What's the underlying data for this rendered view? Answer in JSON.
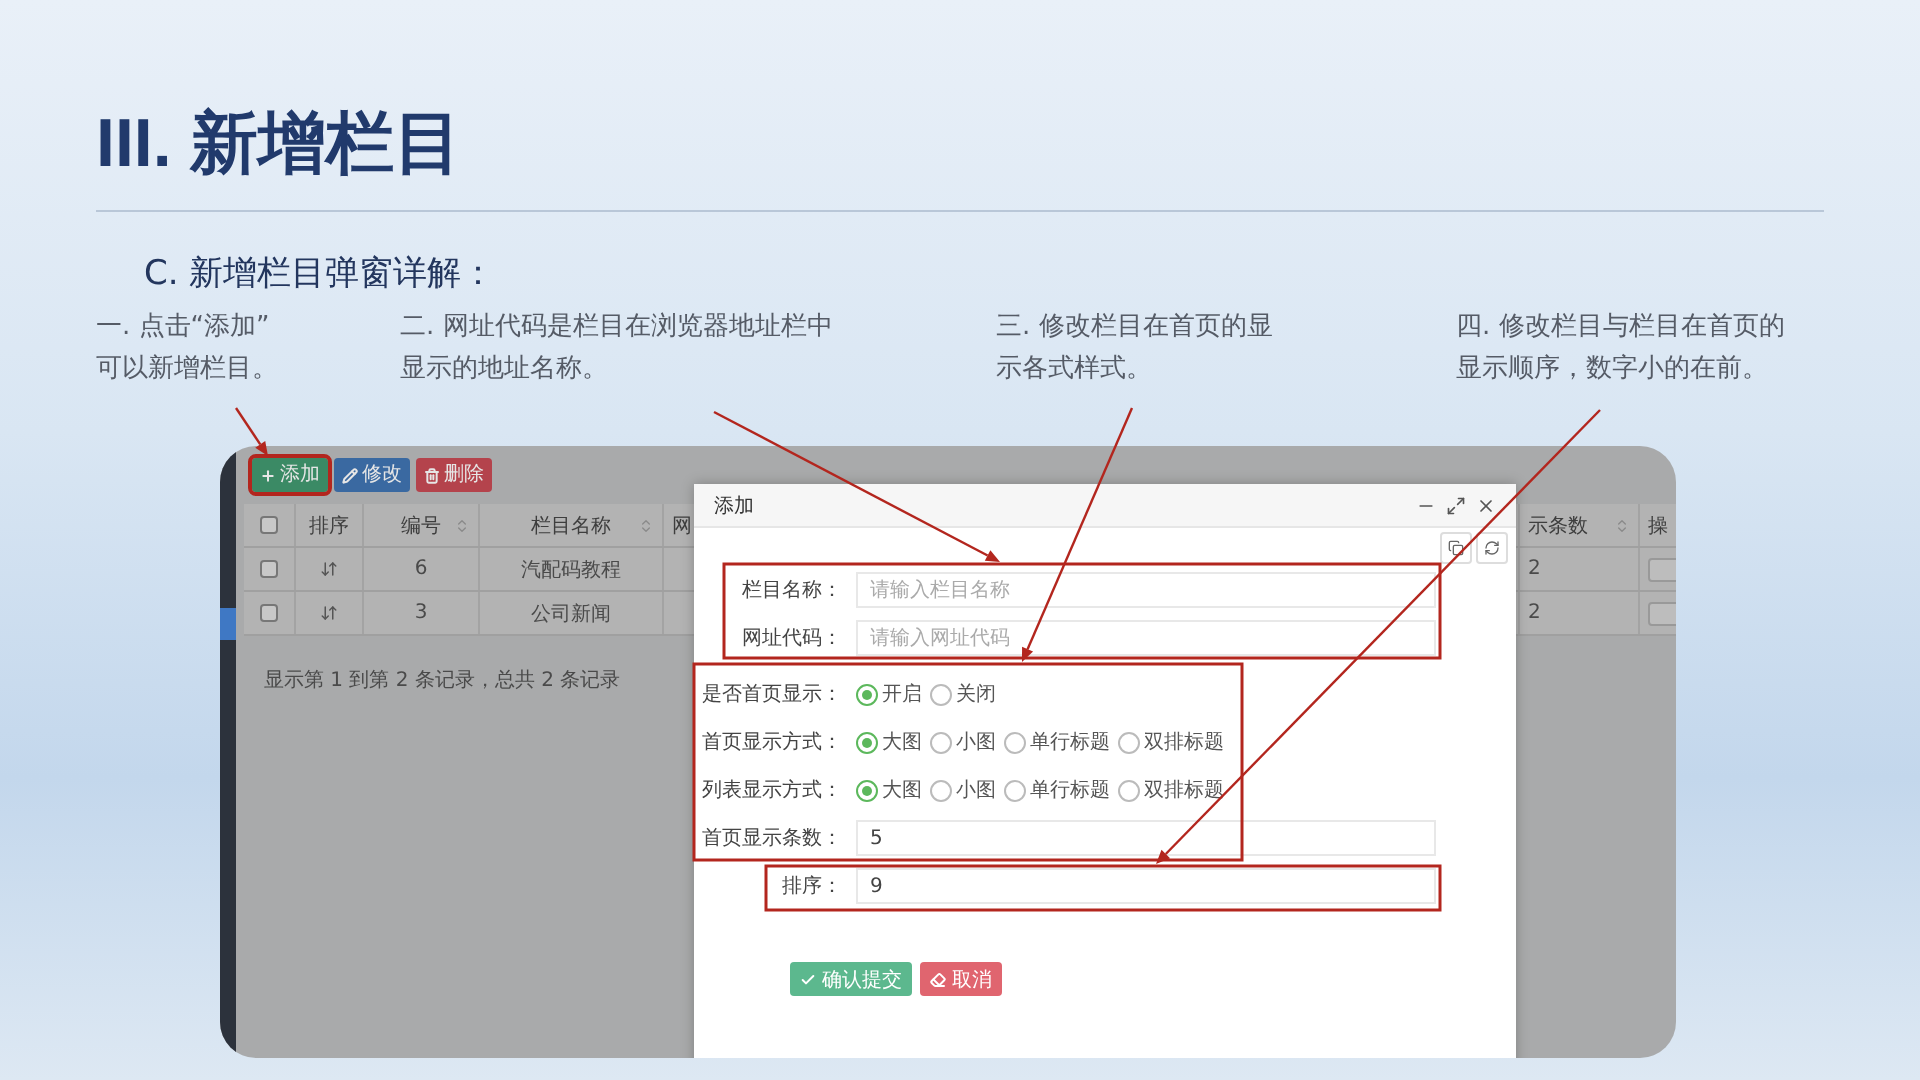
{
  "slide": {
    "title": "III. 新增栏目",
    "subtitle": "C. 新增栏目弹窗详解：",
    "notes": [
      {
        "lines": [
          "一. 点击“添加”",
          "可以新增栏目。"
        ]
      },
      {
        "lines": [
          "二. 网址代码是栏目在浏览器地址栏中",
          "显示的地址名称。"
        ]
      },
      {
        "lines": [
          "三. 修改栏目在首页的显",
          "示各式样式。"
        ]
      },
      {
        "lines": [
          "四. 修改栏目与栏目在首页的",
          "显示顺序，数字小的在前。"
        ]
      }
    ]
  },
  "app": {
    "toolbar": [
      {
        "kind": "add",
        "label": "添加",
        "highlighted": true
      },
      {
        "kind": "edit",
        "label": "修改",
        "highlighted": false
      },
      {
        "kind": "delete",
        "label": "删除",
        "highlighted": false
      }
    ],
    "table": {
      "header_checked": false,
      "columns": [
        {
          "kind": "check"
        },
        {
          "kind": "drag",
          "label": "排序"
        },
        {
          "kind": "id",
          "label": "编号",
          "sortable": true
        },
        {
          "kind": "name",
          "label": "栏目名称",
          "sortable": true
        },
        {
          "kind": "hidden",
          "label": "网"
        },
        {
          "kind": "count",
          "label": "示条数",
          "sortable": true
        },
        {
          "kind": "action",
          "label": "操"
        }
      ],
      "rows": [
        {
          "checked": false,
          "id": "6",
          "name": "汽配码教程",
          "count": "2"
        },
        {
          "checked": false,
          "id": "3",
          "name": "公司新闻",
          "count": "2"
        }
      ],
      "footer": "显示第 1 到第 2 条记录，总共 2 条记录"
    },
    "modal": {
      "title": "添加",
      "fields": [
        {
          "kind": "text",
          "label": "栏目名称：",
          "placeholder": "请输入栏目名称"
        },
        {
          "kind": "text",
          "label": "网址代码：",
          "placeholder": "请输入网址代码"
        },
        {
          "kind": "radio",
          "label": "是否首页显示：",
          "options": [
            {
              "label": "开启",
              "selected": true
            },
            {
              "label": "关闭",
              "selected": false
            }
          ]
        },
        {
          "kind": "radio",
          "label": "首页显示方式：",
          "options": [
            {
              "label": "大图",
              "selected": true
            },
            {
              "label": "小图",
              "selected": false
            },
            {
              "label": "单行标题",
              "selected": false
            },
            {
              "label": "双排标题",
              "selected": false
            }
          ]
        },
        {
          "kind": "radio",
          "label": "列表显示方式：",
          "options": [
            {
              "label": "大图",
              "selected": true
            },
            {
              "label": "小图",
              "selected": false
            },
            {
              "label": "单行标题",
              "selected": false
            },
            {
              "label": "双排标题",
              "selected": false
            }
          ]
        },
        {
          "kind": "text",
          "label": "首页显示条数：",
          "value": "5"
        },
        {
          "kind": "text",
          "label": "排序：",
          "value": "9"
        }
      ],
      "buttons": [
        {
          "kind": "submit",
          "label": "确认提交"
        },
        {
          "kind": "cancel",
          "label": "取消"
        }
      ]
    }
  }
}
